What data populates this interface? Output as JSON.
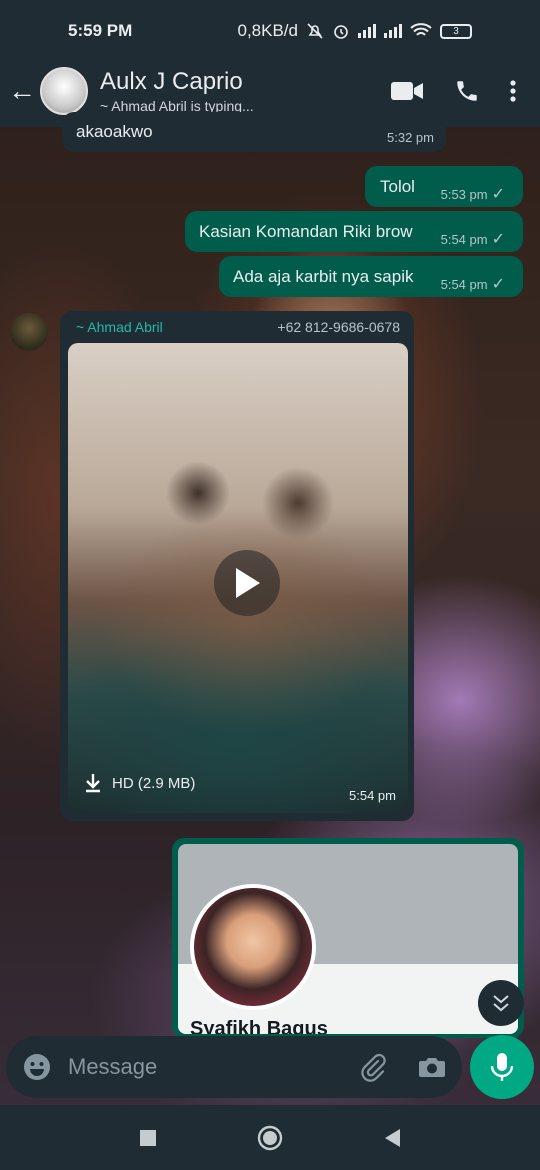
{
  "status": {
    "time": "5:59 PM",
    "net_speed": "0,8KB/d",
    "battery": "3"
  },
  "header": {
    "title": "Aulx J Caprio",
    "subtitle": "~ Ahmad Abril is typing..."
  },
  "messages": {
    "partial_in": {
      "text": "akaoakwo",
      "time": "5:32 pm"
    },
    "out": [
      {
        "text": "Tolol",
        "time": "5:53 pm"
      },
      {
        "text": "Kasian Komandan Riki brow",
        "time": "5:54 pm"
      },
      {
        "text": "Ada aja karbit nya sapik",
        "time": "5:54 pm"
      }
    ],
    "video": {
      "sender": "~ Ahmad Abril",
      "phone": "+62 812-9686-0678",
      "quality": "HD (2.9 MB)",
      "time": "5:54 pm"
    },
    "contact": {
      "name": "Syafikh Bagus"
    }
  },
  "input": {
    "placeholder": "Message"
  },
  "colors": {
    "accent": "#00a884",
    "outgoing": "#005c4b",
    "incoming": "#1f2c34"
  },
  "icons": [
    "back-arrow-icon",
    "video-call-icon",
    "phone-icon",
    "more-icon",
    "emoji-icon",
    "attach-icon",
    "camera-icon",
    "mic-icon",
    "play-icon",
    "download-icon",
    "double-chevron-down-icon"
  ]
}
